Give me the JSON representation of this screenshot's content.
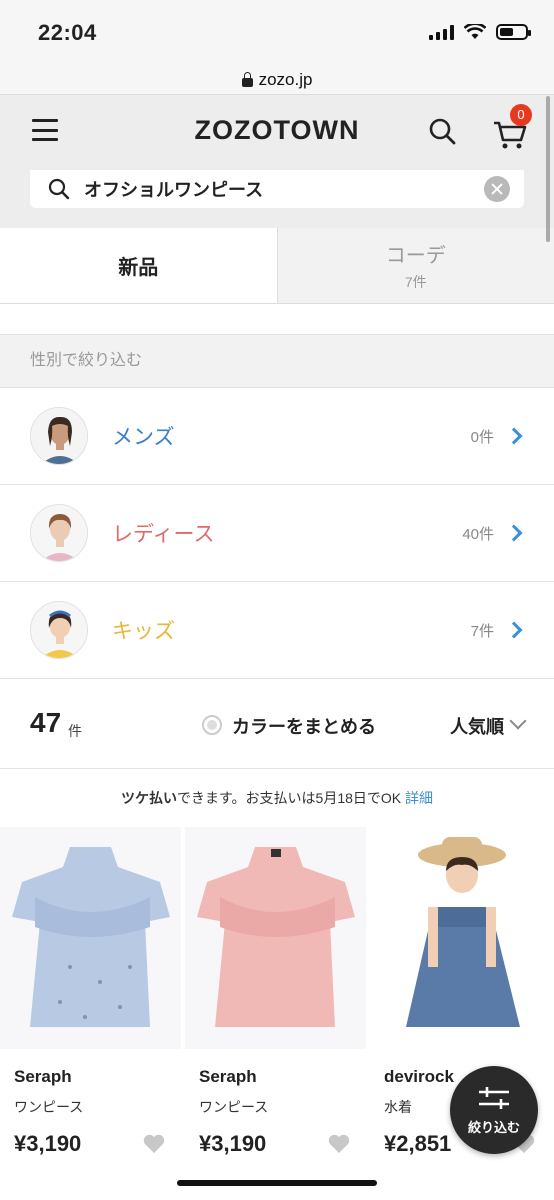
{
  "status_bar": {
    "time": "22:04"
  },
  "browser": {
    "url": "zozo.jp"
  },
  "header": {
    "logo": "ZOZOTOWN",
    "cart_count": "0"
  },
  "search": {
    "query": "オフショルワンピース"
  },
  "tabs": [
    {
      "label": "新品",
      "active": true
    },
    {
      "label": "コーデ",
      "count": "7件",
      "active": false
    }
  ],
  "gender_filter": {
    "heading": "性別で絞り込む",
    "items": [
      {
        "label": "メンズ",
        "count": "0件",
        "color": "#3a7fcf"
      },
      {
        "label": "レディース",
        "count": "40件",
        "color": "#e06a6a"
      },
      {
        "label": "キッズ",
        "count": "7件",
        "color": "#e8b73a"
      }
    ]
  },
  "results": {
    "count": "47",
    "unit": "件",
    "color_group_label": "カラーをまとめる",
    "sort_label": "人気順"
  },
  "notice": {
    "bold": "ツケ払い",
    "text": "できます。お支払いは5月18日でOK",
    "link": "詳細"
  },
  "products": [
    {
      "brand": "Seraph",
      "type": "ワンピース",
      "price": "¥3,190",
      "dress_color": "#b8c9e4"
    },
    {
      "brand": "Seraph",
      "type": "ワンピース",
      "price": "¥3,190",
      "dress_color": "#f1b9b6"
    },
    {
      "brand": "devirock",
      "type": "水着",
      "price": "¥2,851",
      "dress_color": "#5a7aa8"
    }
  ],
  "fab": {
    "label": "絞り込む"
  }
}
